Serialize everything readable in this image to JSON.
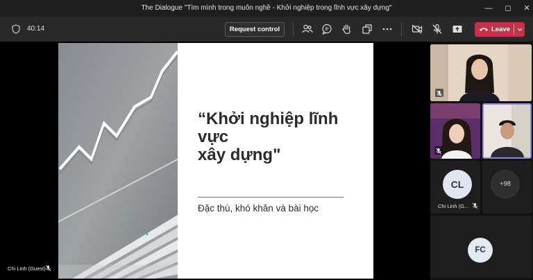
{
  "window": {
    "title": "The Dialogue \"Tìm mình trong muôn nghề - Khởi nghiệp trong lĩnh vực xây dựng\"",
    "controls": [
      "minimize",
      "maximize",
      "close"
    ]
  },
  "toolbar": {
    "timer": "40:14",
    "request_control_label": "Request control",
    "tools": [
      "people-icon",
      "chat-icon",
      "raise-hand-icon",
      "share-tray-icon",
      "more-icon"
    ],
    "controls": [
      "camera-off-icon",
      "mic-off-icon",
      "share-icon"
    ],
    "leave_label": "Leave",
    "leave_color": "#c4314b"
  },
  "slide": {
    "title_line1": "“Khởi nghiệp lĩnh",
    "title_line2": "vực",
    "title_line3": "xây dựng\"",
    "subtitle": "Đặc thù, khó khăn và bài học"
  },
  "presenter": {
    "name": "Chi Linh (Guest)"
  },
  "participants": {
    "cl_initials": "CL",
    "cl_name": "Chi Linh (G...",
    "overflow": "+98",
    "fc_initials": "FC"
  }
}
